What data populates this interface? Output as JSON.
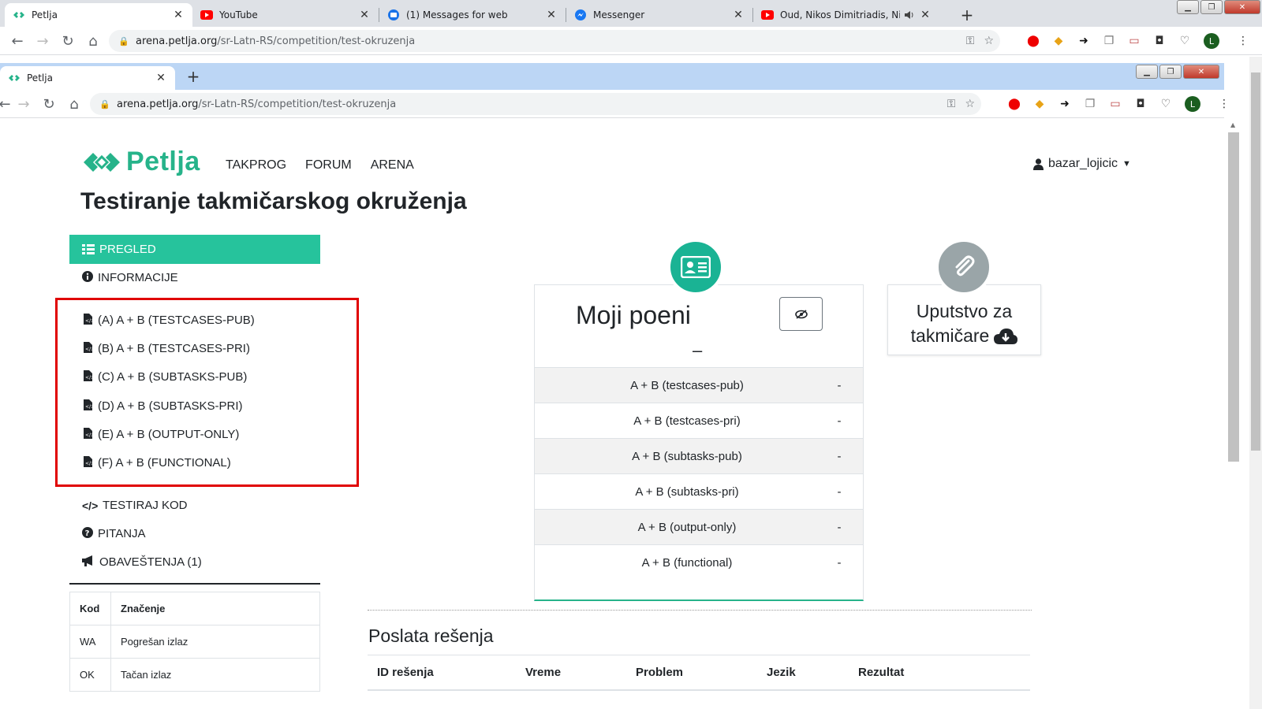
{
  "outer_browser": {
    "tabs": [
      {
        "title": "Petlja",
        "icon": "petlja-icon",
        "active": true
      },
      {
        "title": "YouTube",
        "icon": "youtube-icon"
      },
      {
        "title": "(1) Messages for web",
        "icon": "messages-icon"
      },
      {
        "title": "Messenger",
        "icon": "messenger-icon"
      },
      {
        "title": "Oud, Nikos Dimitriadis, Niko",
        "icon": "youtube-icon"
      }
    ],
    "close_glyph": "✕",
    "new_tab_glyph": "+",
    "url_host": "arena.petlja.org",
    "url_path": "/sr-Latn-RS/competition/test-okruzenja",
    "avatar_letter": "L"
  },
  "inner_browser": {
    "tab_title": "Petlja",
    "close_glyph": "✕",
    "new_tab_glyph": "+",
    "url_host": "arena.petlja.org",
    "url_path": "/sr-Latn-RS/competition/test-okruzenja",
    "avatar_letter": "L"
  },
  "site": {
    "logo_text": "Petlja",
    "nav": [
      "TAKPROG",
      "FORUM",
      "ARENA"
    ],
    "user": "bazar_lojicic",
    "title": "Testiranje takmičarskog okruženja"
  },
  "sidebar": {
    "active": "PREGLED",
    "info": "INFORMACIJE",
    "problems": [
      "(A) A + B (TESTCASES-PUB)",
      "(B) A + B (TESTCASES-PRI)",
      "(C) A + B (SUBTASKS-PUB)",
      "(D) A + B (SUBTASKS-PRI)",
      "(E) A + B (OUTPUT-ONLY)",
      "(F) A + B (FUNCTIONAL)"
    ],
    "test_code": "TESTIRAJ KOD",
    "questions": "PITANJA",
    "notifications": "OBAVEŠTENJA (1)",
    "codes_table": {
      "headers": [
        "Kod",
        "Značenje"
      ],
      "rows": [
        [
          "WA",
          "Pogrešan izlaz"
        ],
        [
          "OK",
          "Tačan izlaz"
        ]
      ]
    }
  },
  "score": {
    "title": "Moji poeni",
    "total": "–",
    "rows": [
      {
        "name": "A + B (testcases-pub)",
        "value": "-"
      },
      {
        "name": "A + B (testcases-pri)",
        "value": "-"
      },
      {
        "name": "A + B (subtasks-pub)",
        "value": "-"
      },
      {
        "name": "A + B (subtasks-pri)",
        "value": "-"
      },
      {
        "name": "A + B (output-only)",
        "value": "-"
      },
      {
        "name": "A + B (functional)",
        "value": "-"
      }
    ]
  },
  "guide": {
    "line1": "Uputstvo za",
    "line2": "takmičare"
  },
  "submissions": {
    "title": "Poslata rešenja",
    "headers": [
      "ID rešenja",
      "Vreme",
      "Problem",
      "Jezik",
      "Rezultat"
    ]
  },
  "colors": {
    "accent": "#26c39c",
    "highlight": "#e00000",
    "guide_icon": "#9aa5a8"
  }
}
